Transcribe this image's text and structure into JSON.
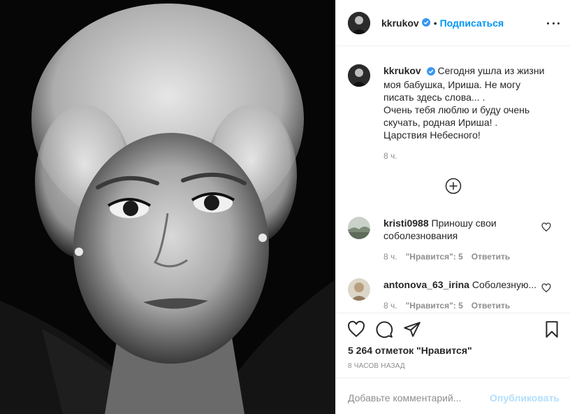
{
  "post": {
    "username": "kkrukov",
    "follow_label": "Подписаться",
    "dot": "•",
    "photo_icon": "portrait-photo"
  },
  "caption": {
    "username": "kkrukov",
    "text_line1": "Сегодня ушла из жизни",
    "text_rest": "моя бабушка, Ириша. Не могу\nписать здесь слова... .\nОчень тебя люблю и буду очень\nскучать, родная Ириша! .\nЦарствия Небесного!",
    "time": "8 ч."
  },
  "comments": [
    {
      "username": "kristi0988",
      "text": "Приношу свои соболезнования",
      "time": "8 ч.",
      "likes": "\"Нравится\": 5",
      "reply": "Ответить"
    },
    {
      "username": "antonova_63_irina",
      "text": "Соболезную...",
      "time": "8 ч.",
      "likes": "\"Нравится\": 5",
      "reply": "Ответить"
    }
  ],
  "actions": {
    "likes_text": "5 264 отметок \"Нравится\"",
    "post_time": "8 часов назад",
    "comment_placeholder": "Добавьте комментарий...",
    "publish_label": "Опубликовать"
  },
  "colors": {
    "accent": "#0095f6",
    "publish_disabled": "#b2dffc",
    "secondary_text": "#8e8e8e",
    "primary_text": "#262626",
    "border": "#efefef"
  }
}
